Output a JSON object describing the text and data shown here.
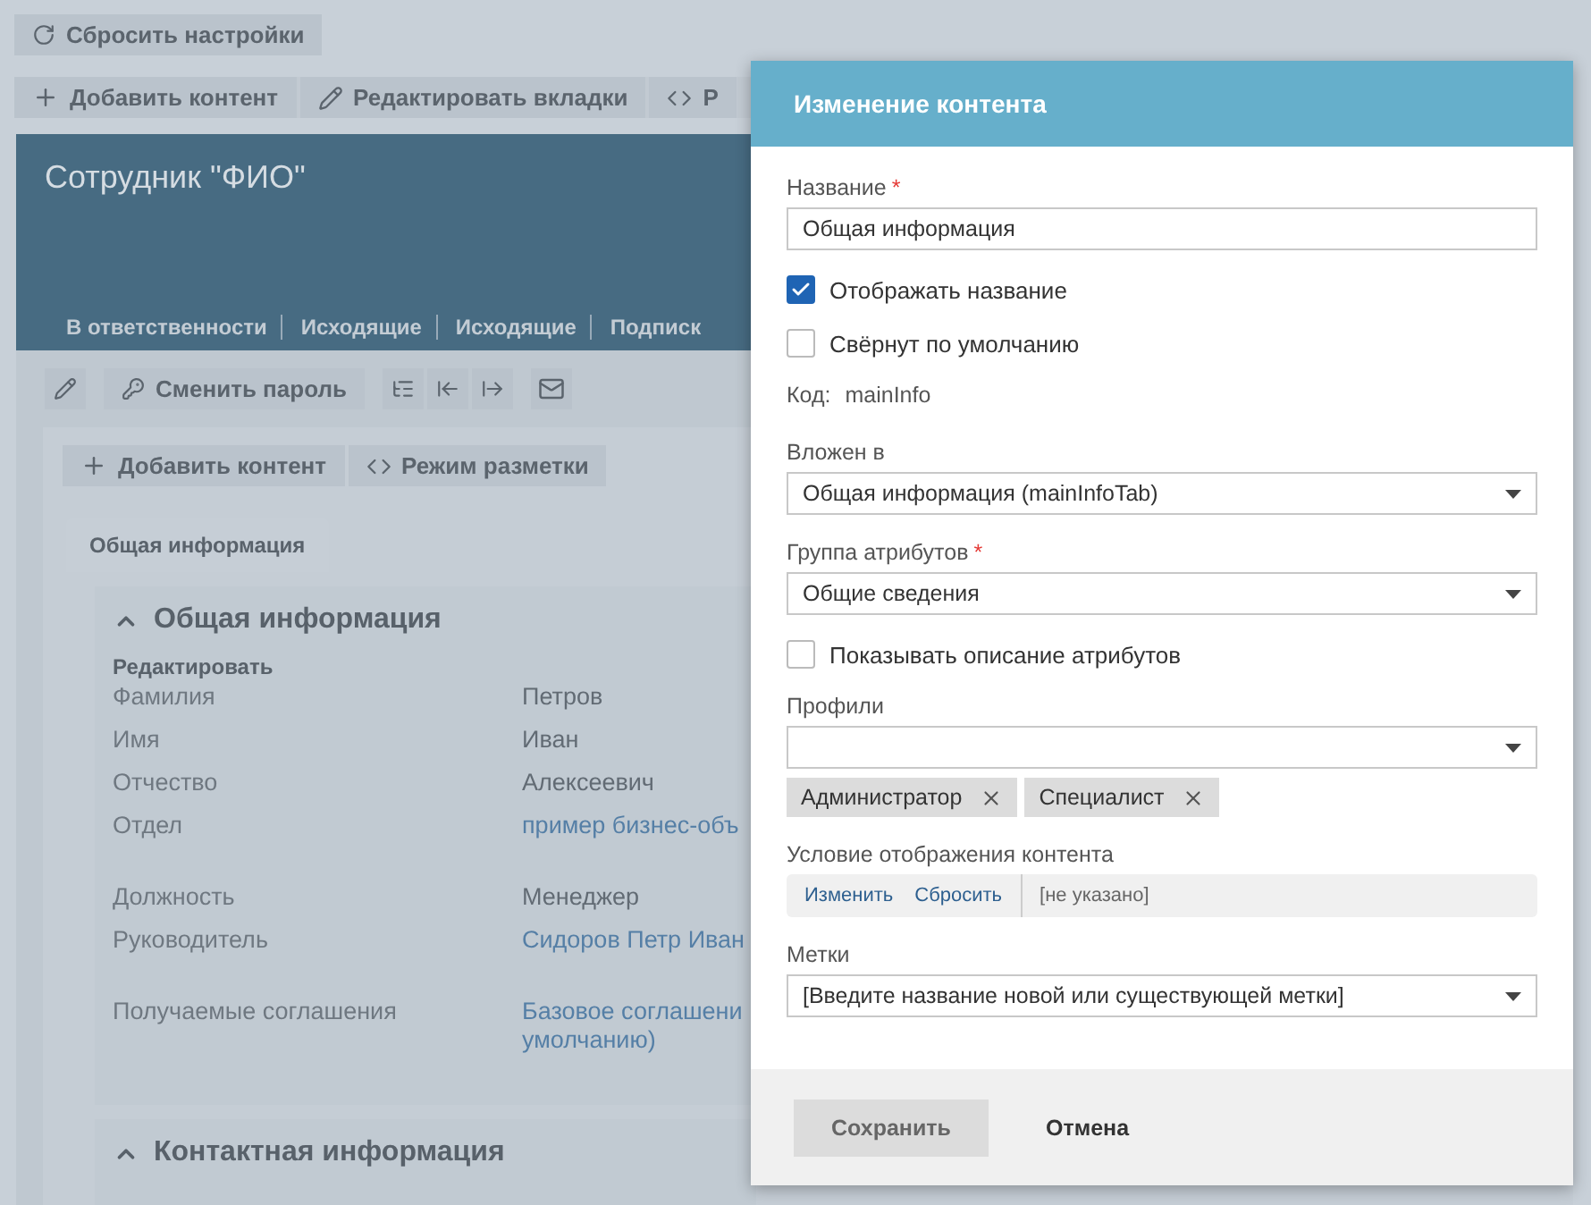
{
  "page_toolbar": {
    "reset_button": "Сбросить настройки",
    "buttons": [
      {
        "kind": "add",
        "label": "Добавить контент"
      },
      {
        "kind": "edit",
        "label": "Редактировать вкладки"
      },
      {
        "kind": "markup",
        "label": "Р"
      }
    ]
  },
  "card": {
    "title": "Сотрудник \"ФИО\"",
    "tabs": [
      "В ответственности",
      "Исходящие",
      "Исходящие",
      "Подписк"
    ]
  },
  "card_toolbar": {
    "password_button": "Сменить пароль"
  },
  "content_toolbar": [
    {
      "kind": "add",
      "label": "Добавить контент"
    },
    {
      "kind": "markup",
      "label": "Режим разметки"
    }
  ],
  "content_tab": "Общая информация",
  "sections": [
    {
      "title": "Общая информация",
      "expanded": true,
      "edit_link": "Редактировать",
      "rows": [
        {
          "label": "Фамилия",
          "value": "Петров",
          "kind": "text"
        },
        {
          "label": "Имя",
          "value": "Иван",
          "kind": "text"
        },
        {
          "label": "Отчество",
          "value": "Алексеевич",
          "kind": "text"
        },
        {
          "label": "Отдел",
          "value": "пример бизнес-объ",
          "kind": "link"
        },
        {
          "label": "Должность",
          "value": "Менеджер",
          "kind": "text"
        },
        {
          "label": "Руководитель",
          "value": "Сидоров Петр Иван",
          "kind": "link"
        },
        {
          "label": "Получаемые соглашения",
          "value": "Базовое соглашени\nумолчанию)",
          "kind": "link"
        }
      ]
    },
    {
      "title": "Контактная информация",
      "expanded": true
    }
  ],
  "modal": {
    "title": "Изменение контента",
    "fields": [
      {
        "kind": "text",
        "label": "Название",
        "required_mark": "*",
        "value": "Общая информация"
      },
      {
        "kind": "checkbox",
        "label": "Отображать название",
        "checked": true
      },
      {
        "kind": "checkbox",
        "label": "Свёрнут по умолчанию",
        "checked": false
      },
      {
        "kind": "code",
        "label": "Код:",
        "value": "mainInfo"
      },
      {
        "kind": "select",
        "label": "Вложен в",
        "value": "Общая информация (mainInfoTab)"
      },
      {
        "kind": "select",
        "label": "Группа атрибутов",
        "required_mark": "*",
        "value": "Общие сведения"
      },
      {
        "kind": "checkbox",
        "label": "Показывать описание атрибутов",
        "checked": false
      },
      {
        "kind": "multiselect",
        "label": "Профили",
        "chips": [
          "Администратор",
          "Специалист"
        ]
      },
      {
        "kind": "condition",
        "label": "Условие отображения контента",
        "actions": [
          "Изменить",
          "Сбросить"
        ],
        "value": "[не указано]"
      },
      {
        "kind": "select",
        "label": "Метки",
        "placeholder": "[Введите название новой или существующей метки]"
      }
    ],
    "save_button": "Сохранить",
    "cancel_button": "Отмена"
  }
}
